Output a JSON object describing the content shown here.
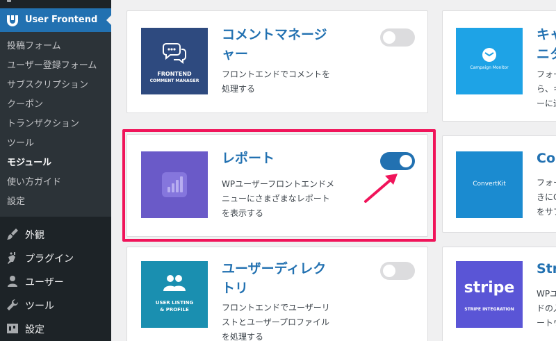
{
  "sidebar": {
    "current": {
      "label": "User Frontend",
      "icon": "user-frontend-logo-icon"
    },
    "submenu": [
      {
        "label": "投稿フォーム",
        "active": false
      },
      {
        "label": "ユーザー登録フォーム",
        "active": false
      },
      {
        "label": "サブスクリプション",
        "active": false
      },
      {
        "label": "クーポン",
        "active": false
      },
      {
        "label": "トランザクション",
        "active": false
      },
      {
        "label": "ツール",
        "active": false
      },
      {
        "label": "モジュール",
        "active": true
      },
      {
        "label": "使い方ガイド",
        "active": false
      },
      {
        "label": "設定",
        "active": false
      }
    ],
    "menu": [
      {
        "label": "外観",
        "icon": "paintbrush-icon"
      },
      {
        "label": "プラグイン",
        "icon": "plugin-icon"
      },
      {
        "label": "ユーザー",
        "icon": "users-icon"
      },
      {
        "label": "ツール",
        "icon": "wrench-icon"
      },
      {
        "label": "設定",
        "icon": "settings-icon"
      }
    ]
  },
  "modules": [
    {
      "title": "コメントマネージャー",
      "description": "フロントエンドでコメントを処理する",
      "enabled": false,
      "thumb_line1": "FRONTEND",
      "thumb_line2": "COMMENT MANAGER",
      "thumb_color": "#2e4a7f"
    },
    {
      "title": "レポート",
      "description": "WPユーザーフロントエンドメニューにさまざまなレポートを表示する",
      "enabled": true,
      "thumb_color": "#6a5ac8"
    },
    {
      "title": "ユーザーディレクトリ",
      "description": "フロントエンドでユーザーリストとユーザープロファイルを処理する",
      "enabled": false,
      "thumb_line1": "USER LISTING",
      "thumb_line2": "& PROFILE",
      "thumb_color": "#1a8fb0"
    }
  ],
  "modules_right": [
    {
      "title": "キャ",
      "title2": "ニタ",
      "desc1": "フォー",
      "desc2": "ら、キ",
      "desc3": "ーに追",
      "thumb_label": "Campaign Monitor",
      "thumb_color": "#1ea3e6"
    },
    {
      "title": "Co",
      "desc1": "フォー",
      "desc2": "きにC",
      "desc3": "をサブ",
      "thumb_label": "ConvertKit",
      "thumb_color": "#1b8bd0"
    },
    {
      "title": "Strip",
      "desc1": "WPユ",
      "desc2": "ドの入",
      "desc3": "ートウ",
      "thumb_label": "stripe",
      "thumb_sub": "STRIPE INTEGRATION",
      "thumb_color": "#5a55d6"
    }
  ],
  "colors": {
    "accent": "#2271b1",
    "highlight": "#f0145a",
    "sidebar_bg": "#1d2327",
    "submenu_bg": "#2c3338"
  }
}
